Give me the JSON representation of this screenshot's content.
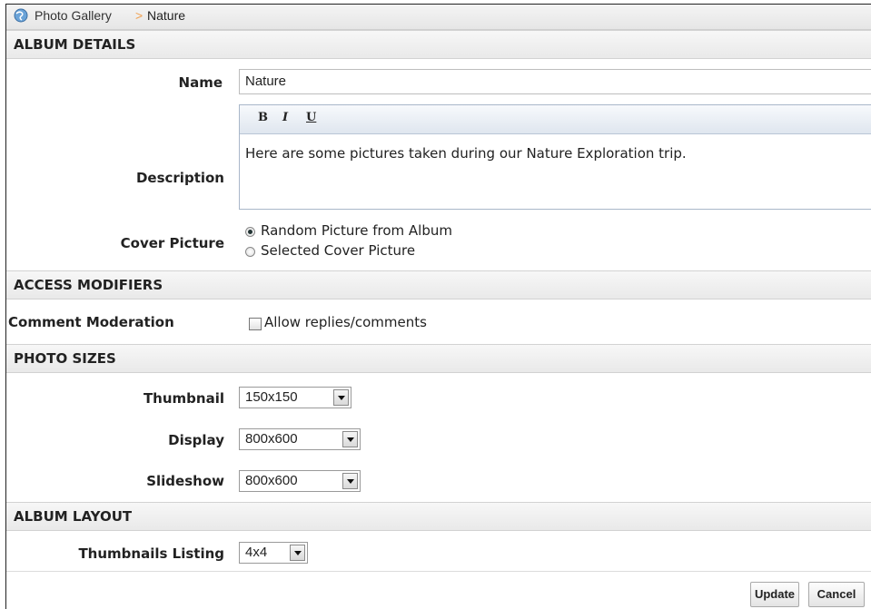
{
  "breadcrumb": {
    "root": "Photo Gallery",
    "separator": ">",
    "current": "Nature",
    "icon": "globe-icon"
  },
  "sections": {
    "album_details": "ALBUM DETAILS",
    "access_modifiers": "ACCESS MODIFIERS",
    "photo_sizes": "PHOTO SIZES",
    "album_layout": "ALBUM LAYOUT"
  },
  "fields": {
    "name": {
      "label": "Name",
      "value": "Nature"
    },
    "description": {
      "label": "Description",
      "toolbar": {
        "bold": "B",
        "italic": "I",
        "underline": "U"
      },
      "value": "Here are some pictures taken during our Nature Exploration trip."
    },
    "cover_picture": {
      "label": "Cover Picture",
      "options": [
        "Random Picture from Album",
        "Selected Cover Picture"
      ],
      "selected": "Random Picture from Album"
    },
    "comment_moderation": {
      "label": "Comment Moderation",
      "checkbox_label": "Allow replies/comments",
      "checked": false
    },
    "thumbnail": {
      "label": "Thumbnail",
      "value": "150x150"
    },
    "display": {
      "label": "Display",
      "value": "800x600"
    },
    "slideshow": {
      "label": "Slideshow",
      "value": "800x600"
    },
    "thumbnails_listing": {
      "label": "Thumbnails Listing",
      "value": "4x4"
    }
  },
  "buttons": {
    "update": "Update",
    "cancel": "Cancel"
  }
}
